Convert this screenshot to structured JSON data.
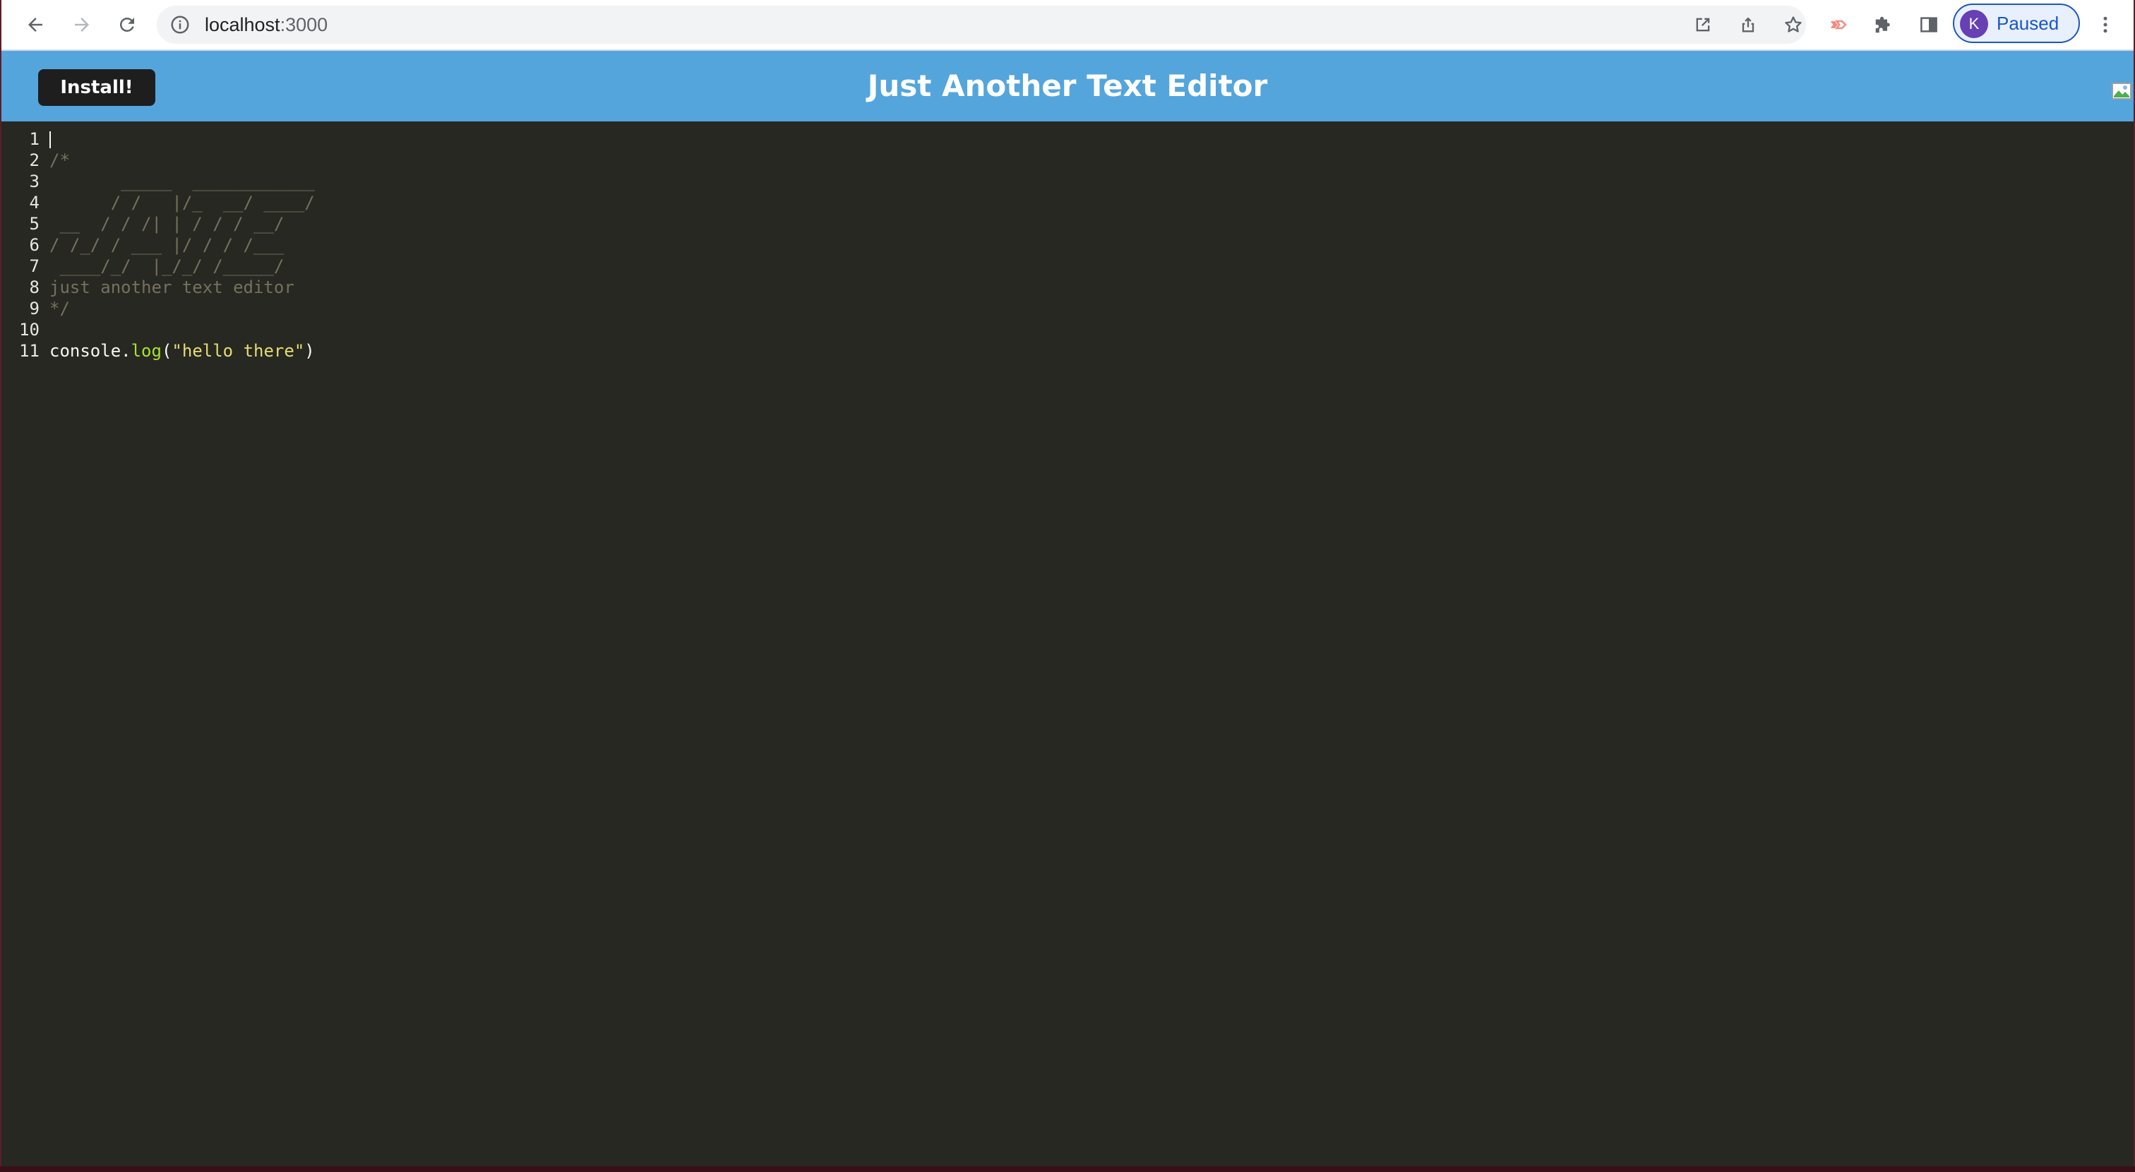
{
  "browser": {
    "url_host": "localhost",
    "url_port": ":3000",
    "profile_initial": "K",
    "profile_status": "Paused",
    "icons": {
      "back": "arrow-left-icon",
      "forward": "arrow-right-icon",
      "reload": "reload-icon",
      "site_info": "info-icon",
      "open_in_app": "open-in-app-icon",
      "share": "share-icon",
      "bookmark": "star-icon",
      "extension_red": "extension-icon",
      "extensions": "puzzle-icon",
      "side_panel": "side-panel-icon",
      "menu": "kebab-menu-icon"
    }
  },
  "app": {
    "install_label": "Install!",
    "title": "Just Another Text Editor",
    "header_color": "#54a5dc",
    "editor_background": "#272822"
  },
  "editor": {
    "line_numbers": [
      "1",
      "2",
      "3",
      "4",
      "5",
      "6",
      "7",
      "8",
      "9",
      "10",
      "11"
    ],
    "lines": [
      {
        "tokens": []
      },
      {
        "tokens": [
          {
            "type": "comment",
            "text": "/*"
          }
        ]
      },
      {
        "tokens": [
          {
            "type": "comment",
            "text": "       _____  ____________"
          }
        ]
      },
      {
        "tokens": [
          {
            "type": "comment",
            "text": "      / /   |/_  __/ ____/"
          }
        ]
      },
      {
        "tokens": [
          {
            "type": "comment",
            "text": " __  / / /| | / / / __/"
          }
        ]
      },
      {
        "tokens": [
          {
            "type": "comment",
            "text": "/ /_/ / ___ |/ / / /___"
          }
        ]
      },
      {
        "tokens": [
          {
            "type": "comment",
            "text": " ____/_/  |_/_/ /_____/"
          }
        ]
      },
      {
        "tokens": [
          {
            "type": "comment",
            "text": "just another text editor"
          }
        ]
      },
      {
        "tokens": [
          {
            "type": "comment",
            "text": "*/"
          }
        ]
      },
      {
        "tokens": []
      },
      {
        "tokens": [
          {
            "type": "plain",
            "text": "console"
          },
          {
            "type": "plain",
            "text": "."
          },
          {
            "type": "fn",
            "text": "log"
          },
          {
            "type": "plain",
            "text": "("
          },
          {
            "type": "str",
            "text": "\"hello there\""
          },
          {
            "type": "plain",
            "text": ")"
          }
        ]
      }
    ]
  }
}
